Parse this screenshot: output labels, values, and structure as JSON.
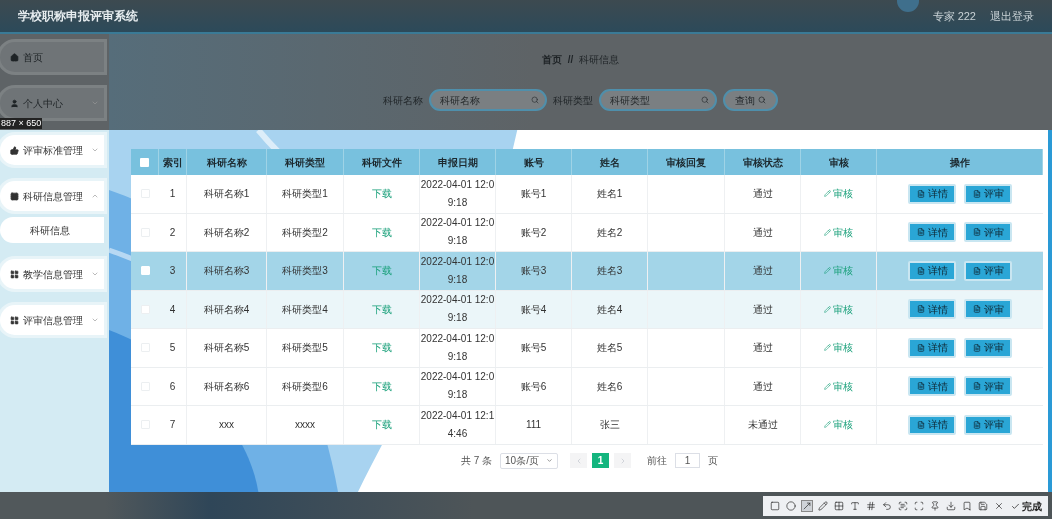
{
  "header": {
    "title": "学校职称申报评审系统",
    "user": "专家 222",
    "logout": "退出登录"
  },
  "sidebar": {
    "items": [
      {
        "label": "首页",
        "expandable": false
      },
      {
        "label": "个人中心",
        "expandable": true,
        "expanded": false
      },
      {
        "label": "评审标准管理",
        "expandable": true,
        "expanded": false
      },
      {
        "label": "科研信息管理",
        "expandable": true,
        "expanded": true,
        "children": [
          {
            "label": "科研信息"
          }
        ]
      },
      {
        "label": "教学信息管理",
        "expandable": true,
        "expanded": false
      },
      {
        "label": "评审信息管理",
        "expandable": true,
        "expanded": false
      }
    ]
  },
  "breadcrumb": {
    "items": [
      "首页",
      "科研信息"
    ],
    "separator": "//"
  },
  "search": {
    "fields": [
      {
        "label": "科研名称",
        "placeholder": "科研名称"
      },
      {
        "label": "科研类型",
        "placeholder": "科研类型"
      }
    ],
    "button": "查询"
  },
  "table": {
    "header_checked": false,
    "columns": [
      "索引",
      "科研名称",
      "科研类型",
      "科研文件",
      "申报日期",
      "账号",
      "姓名",
      "审核回复",
      "审核状态",
      "审核",
      "操作"
    ],
    "rows": [
      {
        "checked": false,
        "hovered": false,
        "shaded": false,
        "index": "1",
        "name": "科研名称1",
        "type": "科研类型1",
        "file": "下载",
        "date": "2022-04-01 12:09:18",
        "account": "账号1",
        "person": "姓名1",
        "status": "通过",
        "review": "审核",
        "actions": [
          "详情",
          "评审"
        ]
      },
      {
        "checked": false,
        "hovered": false,
        "shaded": false,
        "index": "2",
        "name": "科研名称2",
        "type": "科研类型2",
        "file": "下载",
        "date": "2022-04-01 12:09:18",
        "account": "账号2",
        "person": "姓名2",
        "status": "通过",
        "review": "审核",
        "actions": [
          "详情",
          "评审"
        ]
      },
      {
        "checked": false,
        "hovered": true,
        "shaded": false,
        "index": "3",
        "name": "科研名称3",
        "type": "科研类型3",
        "file": "下载",
        "date": "2022-04-01 12:09:18",
        "account": "账号3",
        "person": "姓名3",
        "status": "通过",
        "review": "审核",
        "actions": [
          "详情",
          "评审"
        ]
      },
      {
        "checked": false,
        "hovered": false,
        "shaded": true,
        "index": "4",
        "name": "科研名称4",
        "type": "科研类型4",
        "file": "下载",
        "date": "2022-04-01 12:09:18",
        "account": "账号4",
        "person": "姓名4",
        "status": "通过",
        "review": "审核",
        "actions": [
          "详情",
          "评审"
        ]
      },
      {
        "checked": false,
        "hovered": false,
        "shaded": false,
        "index": "5",
        "name": "科研名称5",
        "type": "科研类型5",
        "file": "下载",
        "date": "2022-04-01 12:09:18",
        "account": "账号5",
        "person": "姓名5",
        "status": "通过",
        "review": "审核",
        "actions": [
          "详情",
          "评审"
        ]
      },
      {
        "checked": false,
        "hovered": false,
        "shaded": false,
        "index": "6",
        "name": "科研名称6",
        "type": "科研类型6",
        "file": "下载",
        "date": "2022-04-01 12:09:18",
        "account": "账号6",
        "person": "姓名6",
        "status": "通过",
        "review": "审核",
        "actions": [
          "详情",
          "评审"
        ]
      },
      {
        "checked": false,
        "hovered": false,
        "shaded": false,
        "index": "7",
        "name": "xxx",
        "type": "xxxx",
        "file": "下载",
        "date": "2022-04-01 12:14:46",
        "account": "111",
        "person": "张三",
        "status": "未通过",
        "review": "审核",
        "actions": [
          "详情",
          "评审"
        ]
      }
    ]
  },
  "pagination": {
    "total": "共 7 条",
    "page_size": "10条/页",
    "pages": [
      {
        "label": "1",
        "selected": true
      }
    ],
    "goto_label": "前往",
    "goto_value": "1",
    "goto_suffix": "页"
  },
  "capture_tool": {
    "size_label": "887 × 650",
    "tools": [
      {
        "selected": false
      },
      {
        "selected": false
      },
      {
        "selected": true
      },
      {
        "selected": false
      },
      {
        "selected": false
      },
      {
        "selected": false
      },
      {
        "selected": false
      },
      {
        "selected": false
      },
      {
        "selected": false
      },
      {
        "selected": false
      },
      {
        "selected": false
      },
      {
        "selected": false
      },
      {
        "selected": false
      },
      {
        "selected": false
      },
      {
        "selected": false
      }
    ],
    "done": "完成"
  }
}
